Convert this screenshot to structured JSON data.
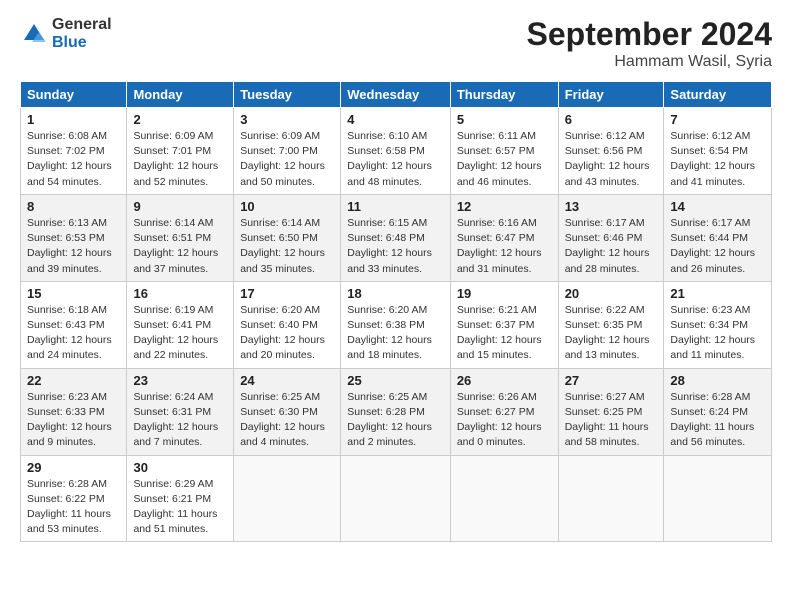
{
  "header": {
    "logo_general": "General",
    "logo_blue": "Blue",
    "title": "September 2024",
    "subtitle": "Hammam Wasil, Syria"
  },
  "weekdays": [
    "Sunday",
    "Monday",
    "Tuesday",
    "Wednesday",
    "Thursday",
    "Friday",
    "Saturday"
  ],
  "weeks": [
    [
      {
        "day": "1",
        "info": "Sunrise: 6:08 AM\nSunset: 7:02 PM\nDaylight: 12 hours and 54 minutes."
      },
      {
        "day": "2",
        "info": "Sunrise: 6:09 AM\nSunset: 7:01 PM\nDaylight: 12 hours and 52 minutes."
      },
      {
        "day": "3",
        "info": "Sunrise: 6:09 AM\nSunset: 7:00 PM\nDaylight: 12 hours and 50 minutes."
      },
      {
        "day": "4",
        "info": "Sunrise: 6:10 AM\nSunset: 6:58 PM\nDaylight: 12 hours and 48 minutes."
      },
      {
        "day": "5",
        "info": "Sunrise: 6:11 AM\nSunset: 6:57 PM\nDaylight: 12 hours and 46 minutes."
      },
      {
        "day": "6",
        "info": "Sunrise: 6:12 AM\nSunset: 6:56 PM\nDaylight: 12 hours and 43 minutes."
      },
      {
        "day": "7",
        "info": "Sunrise: 6:12 AM\nSunset: 6:54 PM\nDaylight: 12 hours and 41 minutes."
      }
    ],
    [
      {
        "day": "8",
        "info": "Sunrise: 6:13 AM\nSunset: 6:53 PM\nDaylight: 12 hours and 39 minutes."
      },
      {
        "day": "9",
        "info": "Sunrise: 6:14 AM\nSunset: 6:51 PM\nDaylight: 12 hours and 37 minutes."
      },
      {
        "day": "10",
        "info": "Sunrise: 6:14 AM\nSunset: 6:50 PM\nDaylight: 12 hours and 35 minutes."
      },
      {
        "day": "11",
        "info": "Sunrise: 6:15 AM\nSunset: 6:48 PM\nDaylight: 12 hours and 33 minutes."
      },
      {
        "day": "12",
        "info": "Sunrise: 6:16 AM\nSunset: 6:47 PM\nDaylight: 12 hours and 31 minutes."
      },
      {
        "day": "13",
        "info": "Sunrise: 6:17 AM\nSunset: 6:46 PM\nDaylight: 12 hours and 28 minutes."
      },
      {
        "day": "14",
        "info": "Sunrise: 6:17 AM\nSunset: 6:44 PM\nDaylight: 12 hours and 26 minutes."
      }
    ],
    [
      {
        "day": "15",
        "info": "Sunrise: 6:18 AM\nSunset: 6:43 PM\nDaylight: 12 hours and 24 minutes."
      },
      {
        "day": "16",
        "info": "Sunrise: 6:19 AM\nSunset: 6:41 PM\nDaylight: 12 hours and 22 minutes."
      },
      {
        "day": "17",
        "info": "Sunrise: 6:20 AM\nSunset: 6:40 PM\nDaylight: 12 hours and 20 minutes."
      },
      {
        "day": "18",
        "info": "Sunrise: 6:20 AM\nSunset: 6:38 PM\nDaylight: 12 hours and 18 minutes."
      },
      {
        "day": "19",
        "info": "Sunrise: 6:21 AM\nSunset: 6:37 PM\nDaylight: 12 hours and 15 minutes."
      },
      {
        "day": "20",
        "info": "Sunrise: 6:22 AM\nSunset: 6:35 PM\nDaylight: 12 hours and 13 minutes."
      },
      {
        "day": "21",
        "info": "Sunrise: 6:23 AM\nSunset: 6:34 PM\nDaylight: 12 hours and 11 minutes."
      }
    ],
    [
      {
        "day": "22",
        "info": "Sunrise: 6:23 AM\nSunset: 6:33 PM\nDaylight: 12 hours and 9 minutes."
      },
      {
        "day": "23",
        "info": "Sunrise: 6:24 AM\nSunset: 6:31 PM\nDaylight: 12 hours and 7 minutes."
      },
      {
        "day": "24",
        "info": "Sunrise: 6:25 AM\nSunset: 6:30 PM\nDaylight: 12 hours and 4 minutes."
      },
      {
        "day": "25",
        "info": "Sunrise: 6:25 AM\nSunset: 6:28 PM\nDaylight: 12 hours and 2 minutes."
      },
      {
        "day": "26",
        "info": "Sunrise: 6:26 AM\nSunset: 6:27 PM\nDaylight: 12 hours and 0 minutes."
      },
      {
        "day": "27",
        "info": "Sunrise: 6:27 AM\nSunset: 6:25 PM\nDaylight: 11 hours and 58 minutes."
      },
      {
        "day": "28",
        "info": "Sunrise: 6:28 AM\nSunset: 6:24 PM\nDaylight: 11 hours and 56 minutes."
      }
    ],
    [
      {
        "day": "29",
        "info": "Sunrise: 6:28 AM\nSunset: 6:22 PM\nDaylight: 11 hours and 53 minutes."
      },
      {
        "day": "30",
        "info": "Sunrise: 6:29 AM\nSunset: 6:21 PM\nDaylight: 11 hours and 51 minutes."
      },
      {
        "day": "",
        "info": ""
      },
      {
        "day": "",
        "info": ""
      },
      {
        "day": "",
        "info": ""
      },
      {
        "day": "",
        "info": ""
      },
      {
        "day": "",
        "info": ""
      }
    ]
  ]
}
